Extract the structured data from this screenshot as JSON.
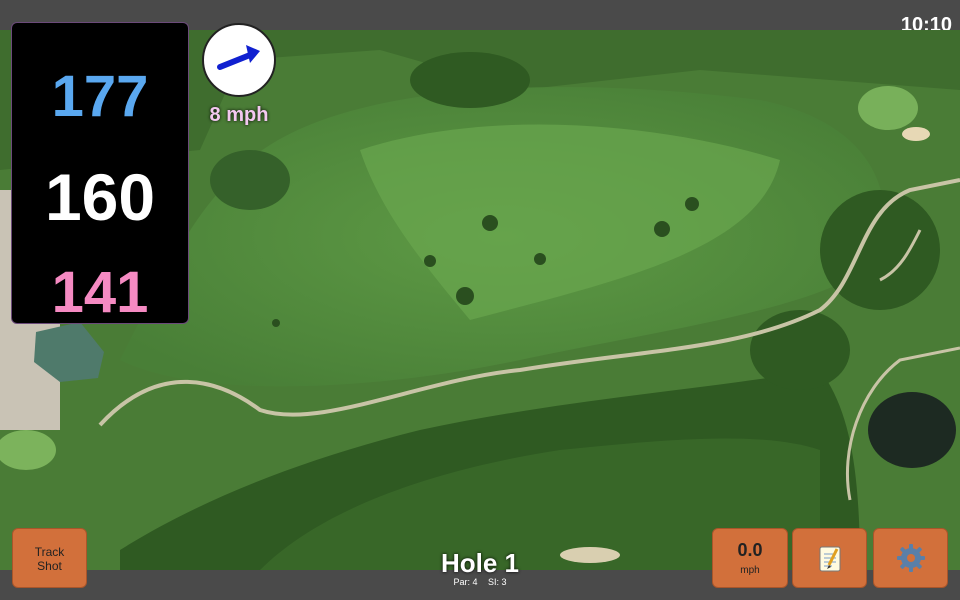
{
  "status_bar": {
    "time": "10:10"
  },
  "distances": {
    "back": "177",
    "center": "160",
    "front": "141"
  },
  "wind": {
    "speed": "8 mph",
    "direction_icon": "arrow-icon"
  },
  "hole": {
    "title": "Hole 1",
    "par": "Par: 4",
    "stroke_index": "SI: 3"
  },
  "buttons": {
    "track_shot_line1": "Track",
    "track_shot_line2": "Shot",
    "speed_value": "0.0",
    "speed_unit": "mph",
    "notes_icon": "notepad-icon",
    "settings_icon": "gear-icon"
  },
  "colors": {
    "back_distance": "#5aa8f0",
    "center_distance": "#ffffff",
    "front_distance": "#f58ac2",
    "button": "#d2703b",
    "wind_speed": "#f3c8f0"
  }
}
